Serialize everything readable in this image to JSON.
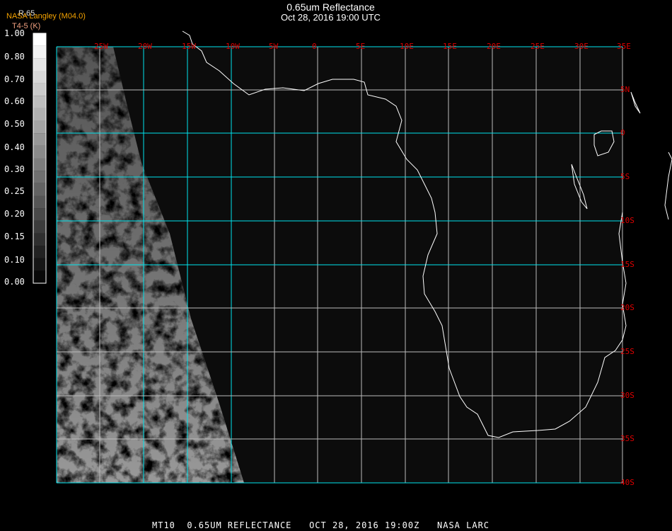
{
  "header": {
    "title": "0.65um Reflectance",
    "subtitle": "Oct 28, 2016 19:00 UTC",
    "organization": "NASA Langley (M04.0)",
    "product_code": "R.65",
    "units": "T4-5 (K)"
  },
  "colorbar": {
    "ticks": [
      "1.00",
      "0.80",
      "0.70",
      "0.60",
      "0.50",
      "0.40",
      "0.30",
      "0.25",
      "0.20",
      "0.15",
      "0.10",
      "0.00"
    ]
  },
  "map": {
    "lon_labels": [
      "25W",
      "20W",
      "15W",
      "10W",
      "5W",
      "0",
      "5E",
      "10E",
      "15E",
      "20E",
      "25E",
      "30E",
      "35E"
    ],
    "lat_labels": [
      "5N",
      "0",
      "5S",
      "10S",
      "15S",
      "20S",
      "25S",
      "30S",
      "35S",
      "40S"
    ],
    "grid_color": "#00e5ee",
    "label_color": "#e00000"
  },
  "footer": {
    "text": "MT10  0.65UM REFLECTANCE   OCT 28, 2016 19:00Z   NASA LARC"
  }
}
